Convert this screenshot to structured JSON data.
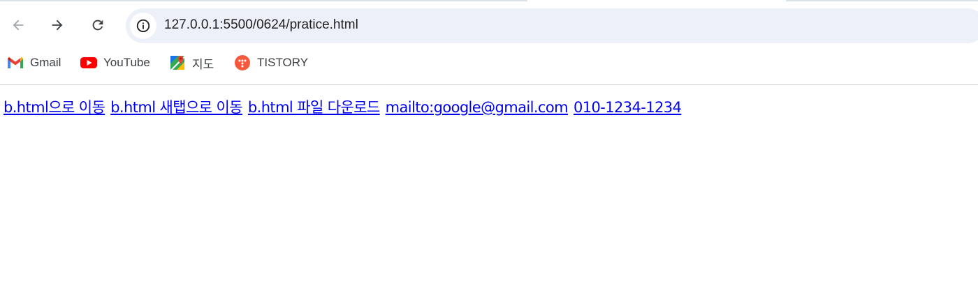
{
  "browser": {
    "url": "127.0.0.1:5500/0624/pratice.html",
    "nav": {
      "back_icon": "arrow-left-icon",
      "forward_icon": "arrow-right-icon",
      "reload_icon": "reload-icon"
    },
    "site_info_icon": "info-circle-icon"
  },
  "bookmarks": [
    {
      "label": "Gmail",
      "icon": "gmail-icon"
    },
    {
      "label": "YouTube",
      "icon": "youtube-icon"
    },
    {
      "label": "지도",
      "icon": "google-maps-icon"
    },
    {
      "label": "TISTORY",
      "icon": "tistory-icon"
    }
  ],
  "page": {
    "links": [
      {
        "text": "b.html으로 이동"
      },
      {
        "text": "b.html 새탭으로 이동"
      },
      {
        "text": "b.html 파일 다운로드"
      },
      {
        "text": "mailto:google@gmail.com"
      },
      {
        "text": "010-1234-1234"
      }
    ]
  },
  "colors": {
    "link": "#0000ee",
    "omnibox_bg": "#edf0f8",
    "youtube_red": "#ff0000",
    "tistory_orange": "#f55a3d"
  }
}
